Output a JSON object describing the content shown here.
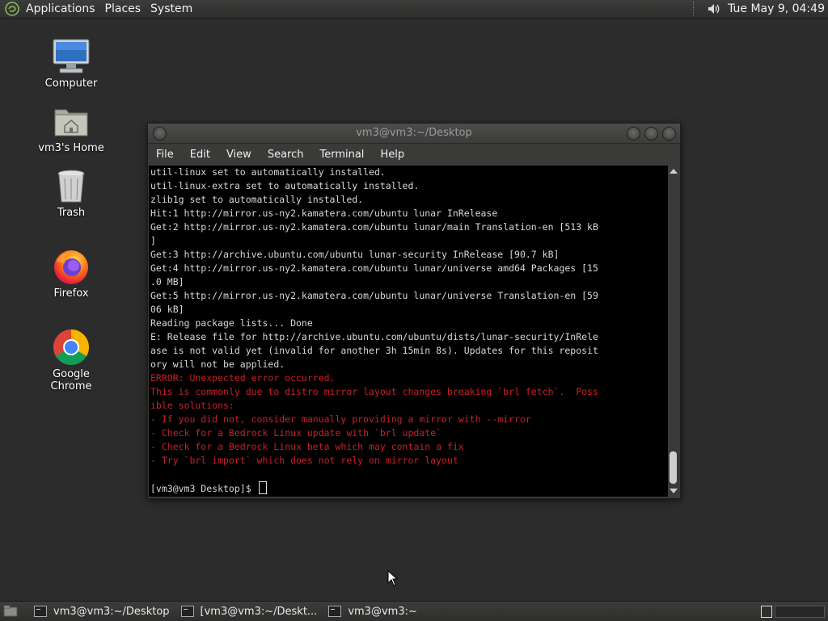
{
  "top_panel": {
    "menus": [
      "Applications",
      "Places",
      "System"
    ],
    "clock": "Tue May  9, 04:49"
  },
  "desktop_icons": [
    {
      "label": "Computer",
      "icon": "computer-icon"
    },
    {
      "label": "vm3's Home",
      "icon": "home-folder-icon"
    },
    {
      "label": "Trash",
      "icon": "trash-icon"
    },
    {
      "label": "Firefox",
      "icon": "firefox-icon"
    },
    {
      "label": "Google Chrome",
      "icon": "chrome-icon"
    }
  ],
  "window": {
    "title": "vm3@vm3:~/Desktop",
    "menus": [
      "File",
      "Edit",
      "View",
      "Search",
      "Terminal",
      "Help"
    ]
  },
  "terminal": {
    "lines": [
      {
        "text": "util-linux set to automatically installed.",
        "type": "out"
      },
      {
        "text": "util-linux-extra set to automatically installed.",
        "type": "out"
      },
      {
        "text": "zlib1g set to automatically installed.",
        "type": "out"
      },
      {
        "text": "Hit:1 http://mirror.us-ny2.kamatera.com/ubuntu lunar InRelease",
        "type": "out"
      },
      {
        "text": "Get:2 http://mirror.us-ny2.kamatera.com/ubuntu lunar/main Translation-en [513 kB",
        "type": "out"
      },
      {
        "text": "]",
        "type": "out"
      },
      {
        "text": "Get:3 http://archive.ubuntu.com/ubuntu lunar-security InRelease [90.7 kB]",
        "type": "out"
      },
      {
        "text": "Get:4 http://mirror.us-ny2.kamatera.com/ubuntu lunar/universe amd64 Packages [15",
        "type": "out"
      },
      {
        "text": ".0 MB]",
        "type": "out"
      },
      {
        "text": "Get:5 http://mirror.us-ny2.kamatera.com/ubuntu lunar/universe Translation-en [59",
        "type": "out"
      },
      {
        "text": "06 kB]",
        "type": "out"
      },
      {
        "text": "Reading package lists... Done",
        "type": "out"
      },
      {
        "text": "E: Release file for http://archive.ubuntu.com/ubuntu/dists/lunar-security/InRele",
        "type": "out"
      },
      {
        "text": "ase is not valid yet (invalid for another 3h 15min 8s). Updates for this reposit",
        "type": "out"
      },
      {
        "text": "ory will not be applied.",
        "type": "out"
      },
      {
        "text": "ERROR: Unexpected error occurred.",
        "type": "err"
      },
      {
        "text": "This is commonly due to distro mirror layout changes breaking `brl fetch`.  Poss",
        "type": "err"
      },
      {
        "text": "ible solutions:",
        "type": "err"
      },
      {
        "text": "- If you did not, consider manually providing a mirror with --mirror",
        "type": "err"
      },
      {
        "text": "- Check for a Bedrock Linux update with `brl update`",
        "type": "err"
      },
      {
        "text": "- Check for a Bedrock Linux beta which may contain a fix",
        "type": "err"
      },
      {
        "text": "- Try `brl import` which does not rely on mirror layout",
        "type": "err"
      },
      {
        "text": "",
        "type": "out"
      }
    ],
    "prompt": "[vm3@vm3 Desktop]$ "
  },
  "taskbar": {
    "tasks": [
      "vm3@vm3:~/Desktop",
      "[vm3@vm3:~/Deskt...",
      "vm3@vm3:~"
    ]
  },
  "colors": {
    "desktop_bg": "#2b2c2b",
    "terminal_bg": "#000000",
    "error_text": "#c8202a",
    "normal_text": "#d8d8d8"
  }
}
